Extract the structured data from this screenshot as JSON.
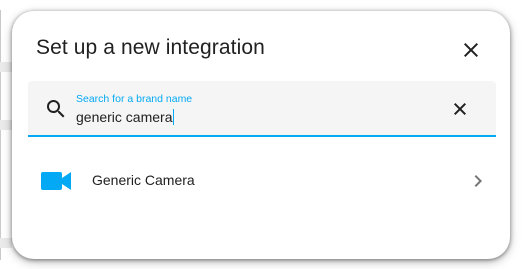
{
  "dialog": {
    "title": "Set up a new integration",
    "close_icon": "close-icon"
  },
  "search": {
    "label": "Search for a brand name",
    "value": "generic camera",
    "search_icon": "magnify-icon",
    "clear_icon": "close-icon"
  },
  "results": [
    {
      "label": "Generic Camera",
      "icon": "video-camera-icon",
      "trailing_icon": "chevron-right-icon"
    }
  ],
  "colors": {
    "accent": "#03a9f4",
    "text": "#212121",
    "field_background": "#f5f5f5"
  }
}
